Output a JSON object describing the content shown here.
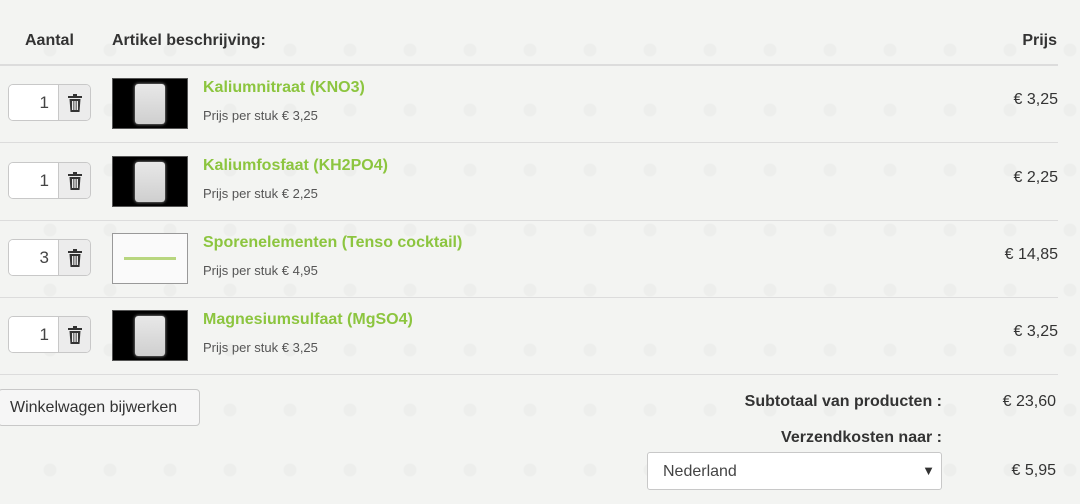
{
  "headers": {
    "qty": "Aantal",
    "description": "Artikel beschrijving:",
    "price": "Prijs"
  },
  "items": [
    {
      "qty": "1",
      "name": "Kaliumnitraat (KNO3)",
      "unit_price": "Prijs per stuk € 3,25",
      "price": "€ 3,25",
      "thumb": "product-bag"
    },
    {
      "qty": "1",
      "name": "Kaliumfosfaat (KH2PO4)",
      "unit_price": "Prijs per stuk € 2,25",
      "price": "€ 2,25",
      "thumb": "product-bag"
    },
    {
      "qty": "3",
      "name": "Sporenelementen (Tenso cocktail)",
      "unit_price": "Prijs per stuk € 4,95",
      "price": "€ 14,85",
      "thumb": "brand-logo"
    },
    {
      "qty": "1",
      "name": "Magnesiumsulfaat (MgSO4)",
      "unit_price": "Prijs per stuk € 3,25",
      "price": "€ 3,25",
      "thumb": "product-bag"
    }
  ],
  "actions": {
    "update_cart": "Winkelwagen bijwerken"
  },
  "totals": {
    "subtotal_label": "Subtotaal van producten :",
    "subtotal_value": "€ 23,60",
    "shipping_label": "Verzendkosten naar :",
    "shipping_country": "Nederland",
    "shipping_value": "€ 5,95"
  },
  "colors": {
    "product_link": "#8cc53f"
  },
  "icons": {
    "remove": "trash-icon",
    "dropdown": "chevron-down-icon"
  }
}
